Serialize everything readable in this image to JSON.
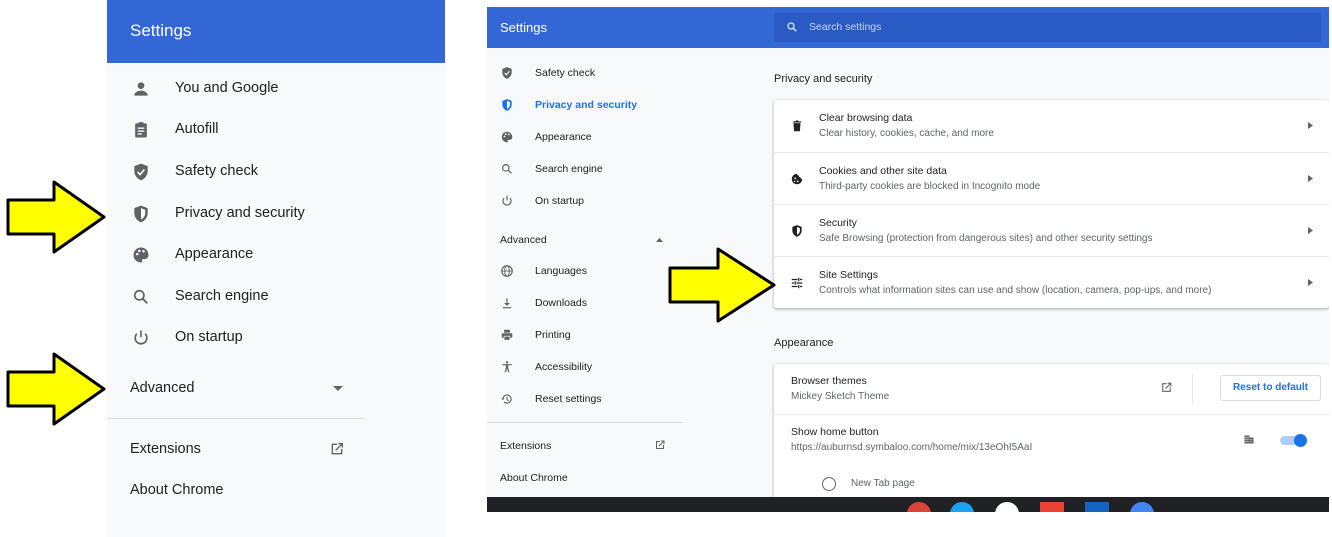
{
  "left_panel": {
    "title": "Settings",
    "items": [
      {
        "label": "You and Google",
        "icon": "person-icon"
      },
      {
        "label": "Autofill",
        "icon": "clipboard-icon"
      },
      {
        "label": "Safety check",
        "icon": "shield-check-icon"
      },
      {
        "label": "Privacy and security",
        "icon": "shield-icon"
      },
      {
        "label": "Appearance",
        "icon": "palette-icon"
      },
      {
        "label": "Search engine",
        "icon": "search-icon"
      },
      {
        "label": "On startup",
        "icon": "power-icon"
      }
    ],
    "advanced_label": "Advanced",
    "extensions_label": "Extensions",
    "about_label": "About Chrome"
  },
  "right_panel": {
    "title": "Settings",
    "search_placeholder": "Search settings",
    "nav": [
      {
        "label": "Safety check",
        "icon": "shield-check-icon"
      },
      {
        "label": "Privacy and security",
        "icon": "shield-icon",
        "active": true
      },
      {
        "label": "Appearance",
        "icon": "palette-icon"
      },
      {
        "label": "Search engine",
        "icon": "search-icon"
      },
      {
        "label": "On startup",
        "icon": "power-icon"
      }
    ],
    "advanced_label": "Advanced",
    "advanced_nav": [
      {
        "label": "Languages",
        "icon": "globe-icon"
      },
      {
        "label": "Downloads",
        "icon": "download-icon"
      },
      {
        "label": "Printing",
        "icon": "printer-icon"
      },
      {
        "label": "Accessibility",
        "icon": "accessibility-icon"
      },
      {
        "label": "Reset settings",
        "icon": "restore-icon"
      }
    ],
    "extensions_label": "Extensions",
    "about_label": "About Chrome",
    "privacy": {
      "section_title": "Privacy and security",
      "rows": [
        {
          "title": "Clear browsing data",
          "subtitle": "Clear history, cookies, cache, and more",
          "icon": "trash-icon"
        },
        {
          "title": "Cookies and other site data",
          "subtitle": "Third-party cookies are blocked in Incognito mode",
          "icon": "cookie-icon"
        },
        {
          "title": "Security",
          "subtitle": "Safe Browsing (protection from dangerous sites) and other security settings",
          "icon": "shield-icon"
        },
        {
          "title": "Site Settings",
          "subtitle": "Controls what information sites can use and show (location, camera, pop-ups, and more)",
          "icon": "tune-icon"
        }
      ]
    },
    "appearance": {
      "section_title": "Appearance",
      "themes_title": "Browser themes",
      "themes_value": "Mickey Sketch Theme",
      "reset_label": "Reset to default",
      "home_title": "Show home button",
      "home_url": "https://auburnsd.symbaloo.com/home/mix/13eOhI5AaI",
      "new_tab_label": "New Tab page",
      "home_toggle_on": true
    }
  },
  "colors": {
    "header_blue": "#3367d6",
    "accent_blue": "#1a73e8",
    "arrow_yellow": "#ffff00"
  }
}
